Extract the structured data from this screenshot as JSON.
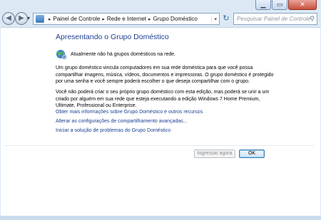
{
  "window": {
    "caption_buttons": {
      "minimize": "▁",
      "maximize": "▭",
      "close": "✕"
    }
  },
  "navigation": {
    "back_glyph": "◀",
    "forward_glyph": "▶",
    "history_glyph": "▾",
    "breadcrumb": [
      "Painel de Controle",
      "Rede e Internet",
      "Grupo Doméstico"
    ],
    "breadcrumb_separator": "▸",
    "address_dropdown_glyph": "▾",
    "refresh_glyph": "↻",
    "search_placeholder": "Pesquisar Painel de Controle",
    "search_icon": "magnifier-icon"
  },
  "main": {
    "heading": "Apresentando o Grupo Doméstico",
    "status_icon": "homegroup-globe-icon",
    "status_text": "Atualmente não há grupos domésticos na rede.",
    "paragraph1": "Um grupo doméstico vincula computadores em sua rede doméstica para que você possa compartilhar imagens, música, vídeos, documentos e impressoras. O grupo doméstico é protegido por uma senha e você sempre poderá escolher o que deseja compartilhar com o grupo.",
    "paragraph2": "Você não poderá criar o seu próprio grupo doméstico com esta edição, mas poderá se unir a um criado por alguém em sua rede que esteja executando a edição Windows 7 Home Premium, Ultimate, Professional ou Enterprise.",
    "links": [
      "Obter mais informações sobre Grupo Doméstico e outros recursos",
      "Alterar as configurações de compartilhamento avançadas...",
      "Iniciar a solução de problemas do Grupo Doméstico"
    ]
  },
  "buttons": {
    "join_now": "Ingressar agora",
    "ok": "OK"
  },
  "colors": {
    "heading": "#1e3d8f",
    "link": "#1a3f94",
    "frame": "#dce9f5"
  }
}
